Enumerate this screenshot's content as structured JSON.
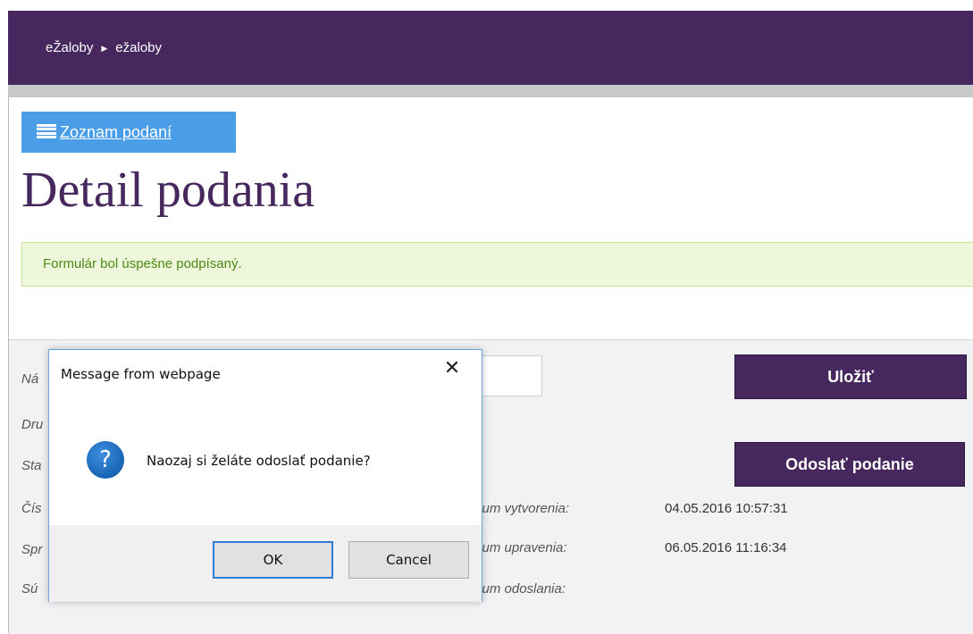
{
  "header": {
    "breadcrumb": [
      "eŽaloby",
      "ežaloby"
    ],
    "separator": "▶"
  },
  "list_button": {
    "label": "Zoznam podaní",
    "icon": "list-icon"
  },
  "page_title": "Detail podania",
  "alert": {
    "text": "Formulár bol úspešne podpísaný.",
    "color": "#4b8a13"
  },
  "form": {
    "labels": [
      "Ná",
      "Dru",
      "Sta",
      "Čís",
      "Spr",
      "Sú"
    ],
    "save_label": "Uložiť",
    "send_label": "Odoslať podanie",
    "meta": [
      {
        "label": "átum vytvorenia:",
        "value": "04.05.2016 10:57:31"
      },
      {
        "label": "átum upravenia:",
        "value": "06.05.2016 11:16:34"
      },
      {
        "label": "átum odoslania:",
        "value": ""
      }
    ]
  },
  "dialog": {
    "title": "Message from webpage",
    "message": "Naozaj si želáte odoslať podanie?",
    "icon": "question-icon",
    "ok_label": "OK",
    "cancel_label": "Cancel",
    "close_glyph": "✕"
  },
  "colors": {
    "brand": "#47285e",
    "accent": "#4a9ee8"
  }
}
